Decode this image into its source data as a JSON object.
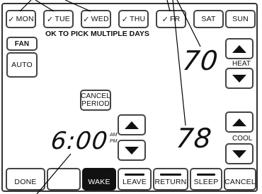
{
  "days": [
    {
      "label": "MON",
      "checked": true
    },
    {
      "label": "TUE",
      "checked": true
    },
    {
      "label": "WED",
      "checked": true
    },
    {
      "label": "THU",
      "checked": true
    },
    {
      "label": "FR",
      "checked": true
    },
    {
      "label": "SAT",
      "checked": false
    },
    {
      "label": "SUN",
      "checked": false
    }
  ],
  "check_glyph": "✓",
  "hint": "OK TO PICK MULTIPLE DAYS",
  "fan": {
    "title": "FAN",
    "mode": "AUTO"
  },
  "heat": {
    "value": "70",
    "label": "HEAT"
  },
  "cool": {
    "value": "78",
    "label": "COOL"
  },
  "cancel_period": {
    "line1": "CANCEL",
    "line2": "PERIOD"
  },
  "time": {
    "value": "6:00",
    "am": "AM",
    "pm": "PM"
  },
  "bottom_buttons": {
    "done": "DONE",
    "blank": "",
    "wake": "WAKE",
    "leave": "LEAVE",
    "return": "RETURN",
    "sleep": "SLEEP",
    "cancel": "CANCEL"
  },
  "colors": {
    "selected_bg": "#111111",
    "selected_fg": "#ffffff",
    "border": "#444444"
  }
}
